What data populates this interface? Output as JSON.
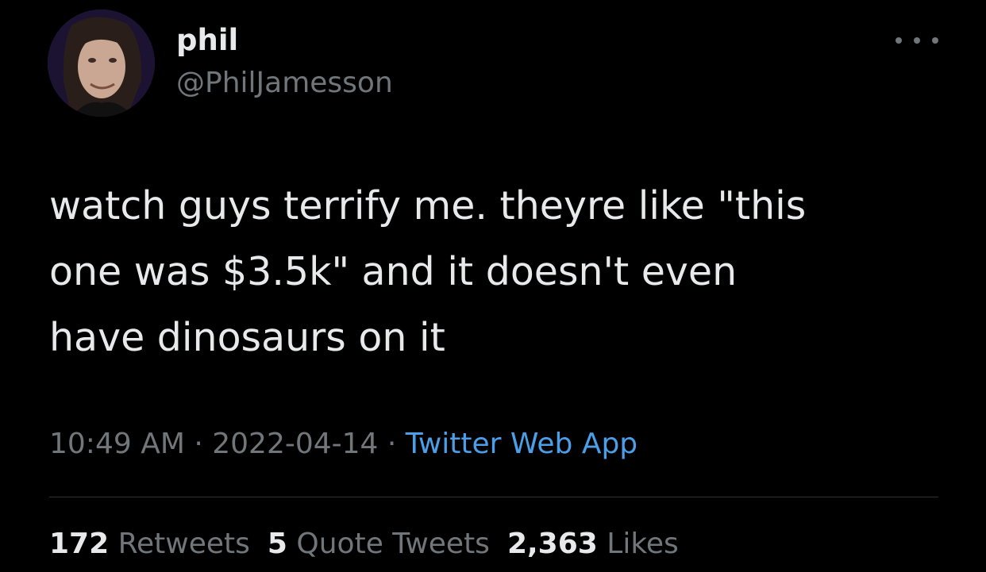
{
  "author": {
    "display_name": "phil",
    "handle": "@PhilJamesson",
    "avatar_icon": "profile-photo"
  },
  "tweet": {
    "text": "watch guys terrify me. theyre like \"this\none was $3.5k\" and it doesn't even\nhave dinosaurs on it",
    "time": "10:49 AM",
    "separator_1": " · ",
    "date": "2022-04-14",
    "separator_2": " · ",
    "source": "Twitter Web App"
  },
  "stats": {
    "retweets_count": "172",
    "retweets_label": "Retweets",
    "quotes_count": "5",
    "quotes_label": "Quote Tweets",
    "likes_count": "2,363",
    "likes_label": "Likes"
  },
  "colors": {
    "background": "#000000",
    "primary_text": "#e7e9ea",
    "secondary_text": "#71767b",
    "link": "#4a9fe8"
  },
  "icons": {
    "more": "more-horizontal-icon"
  }
}
